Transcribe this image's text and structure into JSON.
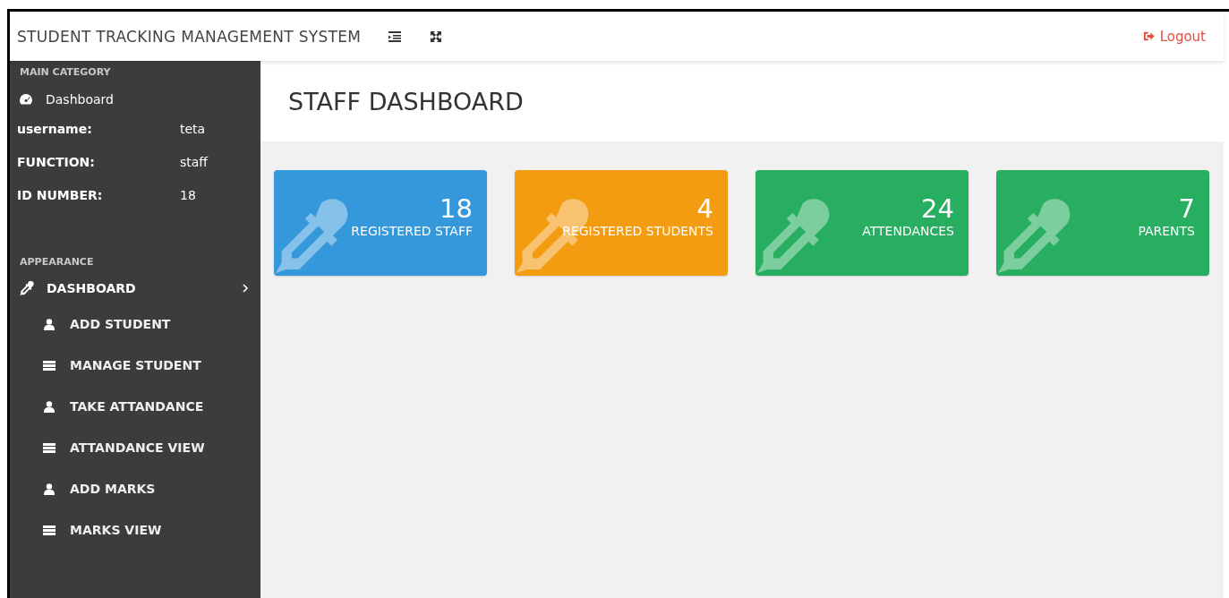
{
  "header": {
    "title": "STUDENT TRACKING MANAGEMENT SYSTEM",
    "logout": "Logout"
  },
  "sidebar": {
    "main_heading": "MAIN CATEGORY",
    "main_item": "Dashboard",
    "info": [
      {
        "label": "username:",
        "value": "teta"
      },
      {
        "label": "FUNCTION:",
        "value": "staff"
      },
      {
        "label": "ID NUMBER:",
        "value": "18"
      }
    ],
    "appearance_heading": "APPEARANCE",
    "section": {
      "label": "DASHBOARD",
      "expanded": true
    },
    "items": [
      {
        "label": "ADD STUDENT",
        "kind": "user"
      },
      {
        "label": "MANAGE STUDENT",
        "kind": "list"
      },
      {
        "label": "TAKE ATTANDANCE",
        "kind": "user"
      },
      {
        "label": "ATTANDANCE VIEW",
        "kind": "list"
      },
      {
        "label": "ADD MARKS",
        "kind": "user"
      },
      {
        "label": "MARKS VIEW",
        "kind": "list"
      }
    ]
  },
  "page_title": "STAFF DASHBOARD",
  "cards": [
    {
      "count": "18",
      "label": "REGISTERED STAFF",
      "color": "#3498db"
    },
    {
      "count": "4",
      "label": "REGISTERED STUDENTS",
      "color": "#f39c12"
    },
    {
      "count": "24",
      "label": "ATTENDANCES",
      "color": "#27ae60"
    },
    {
      "count": "7",
      "label": "PARENTS",
      "color": "#27ae60"
    }
  ]
}
